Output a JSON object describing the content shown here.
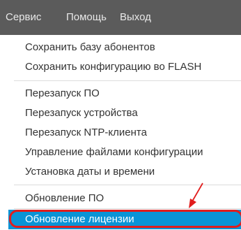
{
  "menubar": {
    "items": [
      {
        "label": "Сервис"
      },
      {
        "label": "Помощь"
      },
      {
        "label": "Выход"
      }
    ]
  },
  "dropdown": {
    "items": [
      {
        "label": "Сохранить базу абонентов"
      },
      {
        "label": "Сохранить конфигурацию во FLASH"
      },
      {
        "label": "Перезапуск ПО"
      },
      {
        "label": "Перезапуск устройства"
      },
      {
        "label": "Перезапуск NTP-клиента"
      },
      {
        "label": "Управление файлами конфигурации"
      },
      {
        "label": "Установка даты и времени"
      },
      {
        "label": "Обновление ПО"
      },
      {
        "label": "Обновление лицензии",
        "state": "highlighted"
      }
    ]
  },
  "colors": {
    "menubar_bg": "#5b5b5b",
    "menubar_text": "#e8e8e8",
    "item_text": "#333333",
    "active_bg": "#0a94d6",
    "active_text": "#ffffff",
    "annotation": "#e11d1d"
  }
}
